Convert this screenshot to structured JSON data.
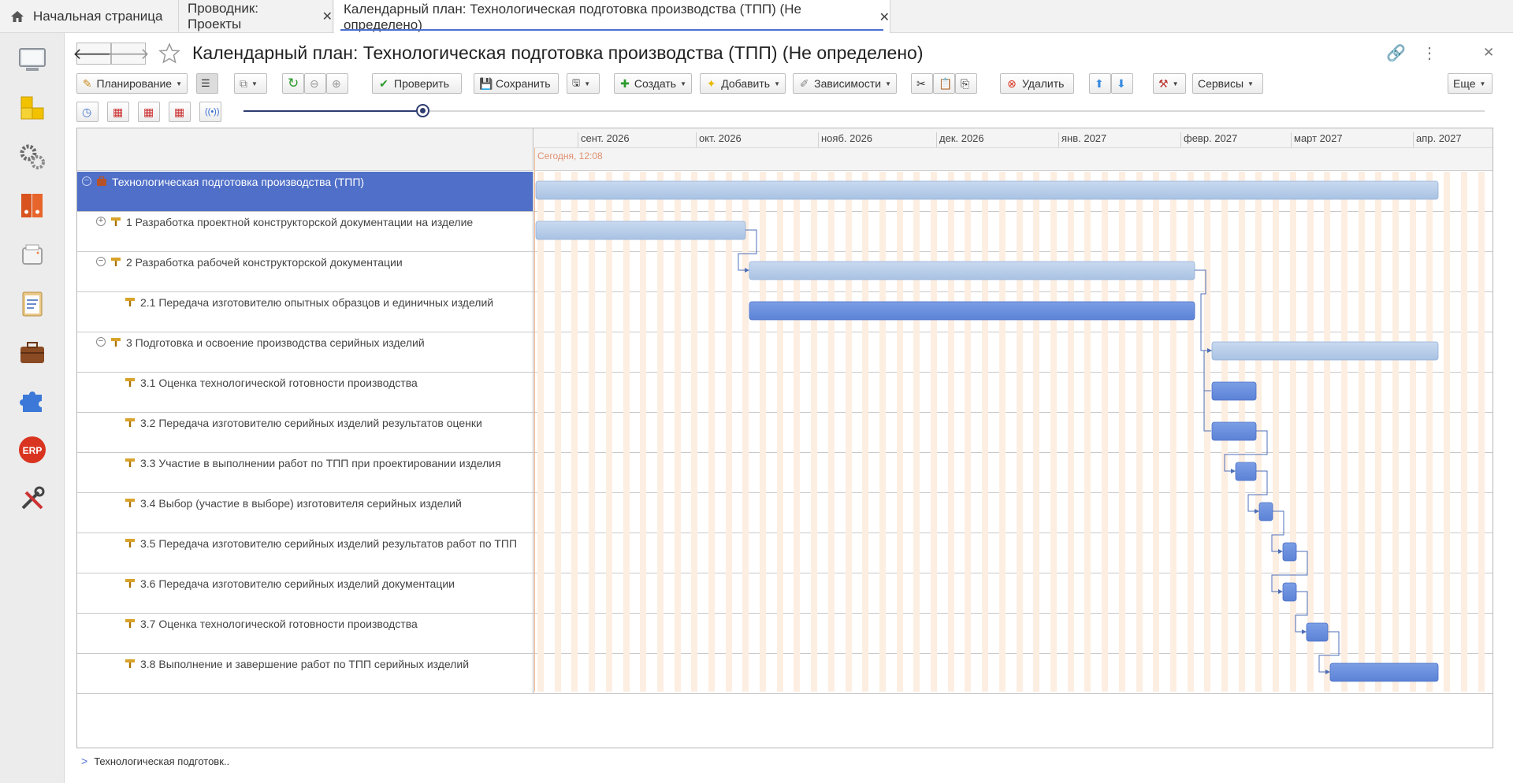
{
  "tabs": [
    {
      "label": "Начальная страница"
    },
    {
      "label": "Проводник: Проекты"
    },
    {
      "label": "Календарный план: Технологическая подготовка производства (ТПП) (Не определено)"
    }
  ],
  "page_title": "Календарный план: Технологическая подготовка производства (ТПП) (Не определено)",
  "toolbar": {
    "planning": "Планирование",
    "check": "Проверить",
    "save": "Сохранить",
    "create": "Создать",
    "add": "Добавить",
    "dependencies": "Зависимости",
    "delete": "Удалить",
    "services": "Сервисы",
    "more": "Еще"
  },
  "gantt": {
    "months": [
      "сент. 2026",
      "окт. 2026",
      "нояб. 2026",
      "дек. 2026",
      "янв. 2027",
      "февр. 2027",
      "март 2027",
      "апр. 2027"
    ],
    "today_label": "Сегодня, 12:08",
    "tasks": [
      {
        "label": "Технологическая подготовка производства (ТПП)",
        "level": 0,
        "toggle": "collapse",
        "kind": "project"
      },
      {
        "label": "1 Разработка проектной конструкторской документации на изделие",
        "level": 1,
        "toggle": "expand",
        "kind": "summary"
      },
      {
        "label": "2 Разработка рабочей конструкторской документации",
        "level": 1,
        "toggle": "collapse",
        "kind": "summary"
      },
      {
        "label": "2.1 Передача изготовителю опытных образцов и единичных изделий",
        "level": 2,
        "toggle": "",
        "kind": "task"
      },
      {
        "label": "3 Подготовка и освоение производства серийных изделий",
        "level": 1,
        "toggle": "collapse",
        "kind": "summary"
      },
      {
        "label": "3.1 Оценка технологической готовности производства",
        "level": 2,
        "toggle": "",
        "kind": "task"
      },
      {
        "label": "3.2 Передача изготовителю серийных изделий результатов оценки",
        "level": 2,
        "toggle": "",
        "kind": "task"
      },
      {
        "label": "3.3 Участие в выполнении работ по ТПП при проектировании изделия",
        "level": 2,
        "toggle": "",
        "kind": "task"
      },
      {
        "label": "3.4 Выбор (участие в выборе) изготовителя серийных изделий",
        "level": 2,
        "toggle": "",
        "kind": "task"
      },
      {
        "label": "3.5 Передача изготовителю серийных изделий результатов работ по ТПП",
        "level": 2,
        "toggle": "",
        "kind": "task"
      },
      {
        "label": "3.6 Передача изготовителю серийных изделий документации",
        "level": 2,
        "toggle": "",
        "kind": "task"
      },
      {
        "label": "3.7 Оценка технологической готовности производства",
        "level": 2,
        "toggle": "",
        "kind": "task"
      },
      {
        "label": "3.8 Выполнение и завершение работ по ТПП серийных изделий",
        "level": 2,
        "toggle": "",
        "kind": "task"
      }
    ]
  },
  "breadcrumb": "Технологическая подготовк..",
  "colors": {
    "selected_row": "#4f6fc8",
    "summary_bar": "#a9c3e3",
    "task_bar": "#5b82d6",
    "today": "#e09070"
  }
}
